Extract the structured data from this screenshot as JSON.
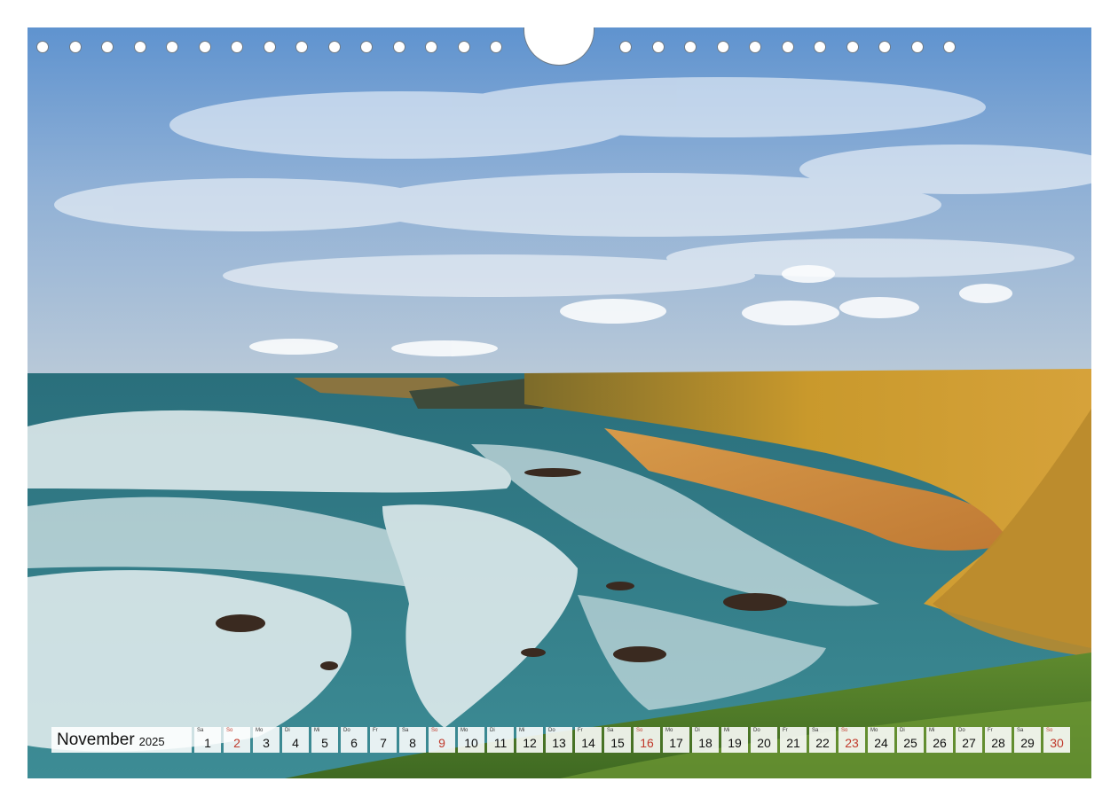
{
  "calendar": {
    "month": "November",
    "year": "2025",
    "days": [
      {
        "wd": "Sa",
        "n": "1",
        "sun": false
      },
      {
        "wd": "So",
        "n": "2",
        "sun": true
      },
      {
        "wd": "Mo",
        "n": "3",
        "sun": false
      },
      {
        "wd": "Di",
        "n": "4",
        "sun": false
      },
      {
        "wd": "Mi",
        "n": "5",
        "sun": false
      },
      {
        "wd": "Do",
        "n": "6",
        "sun": false
      },
      {
        "wd": "Fr",
        "n": "7",
        "sun": false
      },
      {
        "wd": "Sa",
        "n": "8",
        "sun": false
      },
      {
        "wd": "So",
        "n": "9",
        "sun": true
      },
      {
        "wd": "Mo",
        "n": "10",
        "sun": false
      },
      {
        "wd": "Di",
        "n": "11",
        "sun": false
      },
      {
        "wd": "Mi",
        "n": "12",
        "sun": false
      },
      {
        "wd": "Do",
        "n": "13",
        "sun": false
      },
      {
        "wd": "Fr",
        "n": "14",
        "sun": false
      },
      {
        "wd": "Sa",
        "n": "15",
        "sun": false
      },
      {
        "wd": "So",
        "n": "16",
        "sun": true
      },
      {
        "wd": "Mo",
        "n": "17",
        "sun": false
      },
      {
        "wd": "Di",
        "n": "18",
        "sun": false
      },
      {
        "wd": "Mi",
        "n": "19",
        "sun": false
      },
      {
        "wd": "Do",
        "n": "20",
        "sun": false
      },
      {
        "wd": "Fr",
        "n": "21",
        "sun": false
      },
      {
        "wd": "Sa",
        "n": "22",
        "sun": false
      },
      {
        "wd": "So",
        "n": "23",
        "sun": true
      },
      {
        "wd": "Mo",
        "n": "24",
        "sun": false
      },
      {
        "wd": "Di",
        "n": "25",
        "sun": false
      },
      {
        "wd": "Mi",
        "n": "26",
        "sun": false
      },
      {
        "wd": "Do",
        "n": "27",
        "sun": false
      },
      {
        "wd": "Fr",
        "n": "28",
        "sun": false
      },
      {
        "wd": "Sa",
        "n": "29",
        "sun": false
      },
      {
        "wd": "So",
        "n": "30",
        "sun": true
      }
    ]
  },
  "colors": {
    "sunday": "#c0392b",
    "sky": "#6f9fd0",
    "cliff": "#c99a2e",
    "sea": "#2f7f86"
  }
}
